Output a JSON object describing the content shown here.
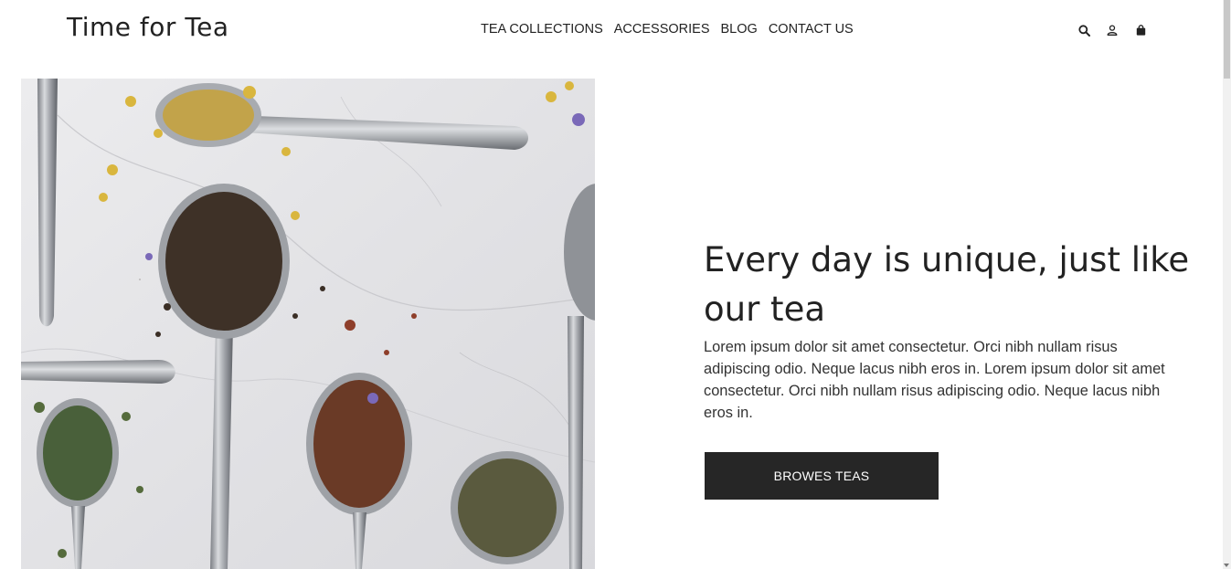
{
  "header": {
    "logo": "Time for Tea",
    "nav": [
      {
        "label": "TEA COLLECTIONS"
      },
      {
        "label": "ACCESSORIES"
      },
      {
        "label": "BLOG"
      },
      {
        "label": "CONTACT US"
      }
    ],
    "icons": [
      "search-icon",
      "user-icon",
      "shopping-bag-icon"
    ]
  },
  "hero": {
    "image": "tea-spoons-image",
    "title": "Every day is unique, just like our tea",
    "body": "Lorem ipsum dolor sit amet consectetur. Orci nibh nullam risus adipiscing odio. Neque lacus nibh eros in. Lorem ipsum dolor sit amet consectetur. Orci nibh nullam risus adipiscing odio. Neque lacus nibh eros in.",
    "cta_label": "BROWES TEAS"
  },
  "colors": {
    "text": "#222222",
    "button_bg": "#262626",
    "button_text": "#ffffff",
    "background": "#ffffff"
  }
}
